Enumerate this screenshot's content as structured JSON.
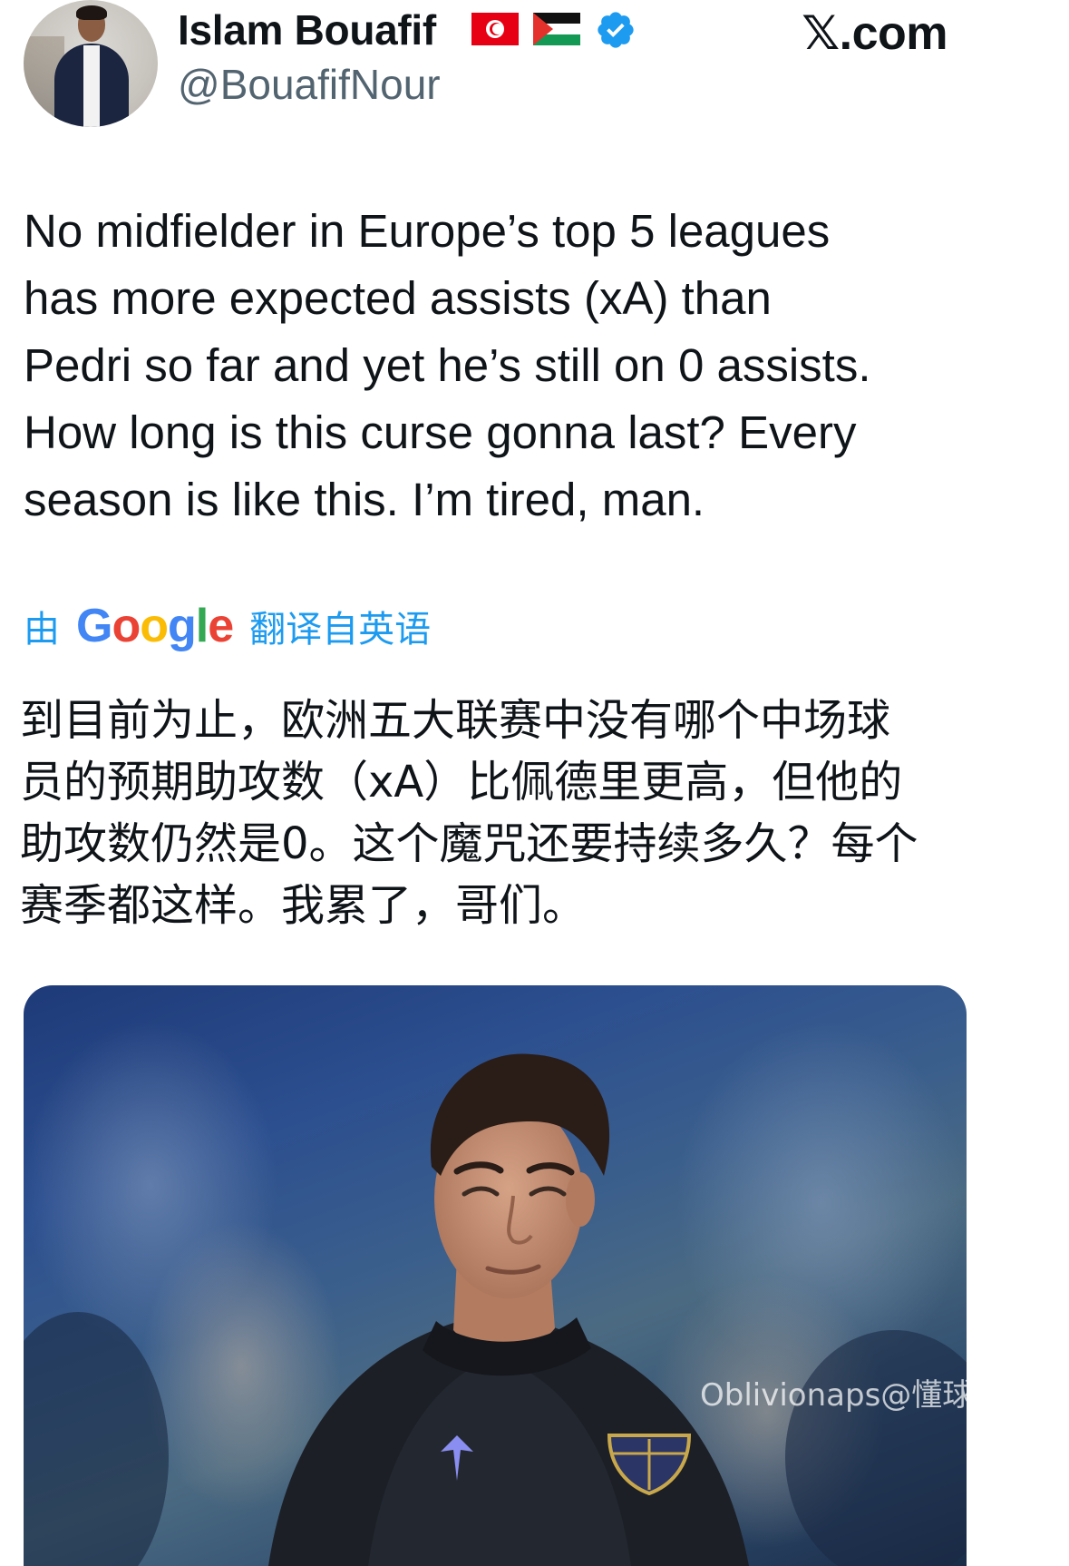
{
  "author": {
    "display_name": "Islam Bouafif",
    "handle": "@BouafifNour",
    "avatar_icon": "profile-photo",
    "flags": [
      "tunisia-flag-icon",
      "palestine-flag-icon"
    ],
    "verified_color": "#1d9bf0"
  },
  "site": {
    "logo_text": "𝕏.com"
  },
  "tweet": {
    "text": "No midfielder in Europe’s top 5 leagues\nhas more expected assists (xA) than\nPedri so far and yet he’s still on 0 assists.\nHow long is this curse gonna last? Every\nseason is like this. I’m tired, man."
  },
  "translation": {
    "prefix": "由",
    "google_letters": [
      "G",
      "o",
      "o",
      "g",
      "l",
      "e"
    ],
    "suffix": "翻译自英语",
    "link_color": "#1d9bf0",
    "text": "到目前为止，欧洲五大联赛中没有哪个中场球\n员的预期助攻数（xA）比佩德里更高，但他的\n助攻数仍然是0。这个魔咒还要持续多久？每个\n赛季都这样。我累了，哥们。"
  },
  "media": {
    "kind": "photo",
    "subject": "player-photo"
  },
  "watermark": {
    "text": "Oblivionaps@懂球帝"
  }
}
